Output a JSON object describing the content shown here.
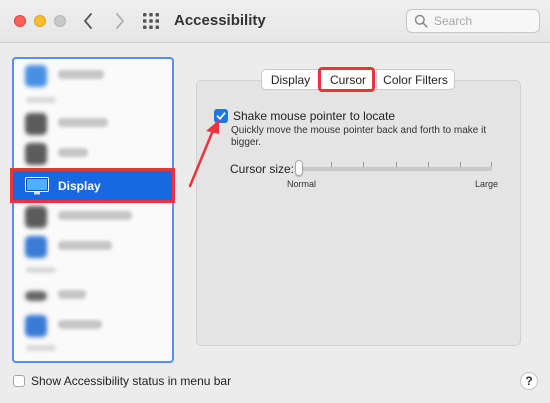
{
  "window": {
    "title": "Accessibility",
    "search_placeholder": "Search"
  },
  "sidebar": {
    "selected_label": "Display",
    "accent_color": "#1869e1",
    "blurred_item_icons": [
      "#4a90e2",
      "#5b5b5b",
      "#5b5b5b",
      "#5b5b5b",
      "#3a7bd5",
      "#666666",
      "#3a7bd5"
    ]
  },
  "tabs": [
    "Display",
    "Cursor",
    "Color Filters"
  ],
  "selected_tab": "Cursor",
  "cursor": {
    "shake_checked": true,
    "shake_label": "Shake mouse pointer to locate",
    "shake_description": "Quickly move the mouse pointer back and forth to make it bigger.",
    "cursor_size_label": "Cursor size:",
    "slider_min_label": "Normal",
    "slider_max_label": "Large",
    "cursor_size_value": 0
  },
  "footer": {
    "status_menu_label": "Show Accessibility status in menu bar",
    "status_menu_checked": false,
    "help_label": "?"
  },
  "annotation_color": "#e8353d"
}
